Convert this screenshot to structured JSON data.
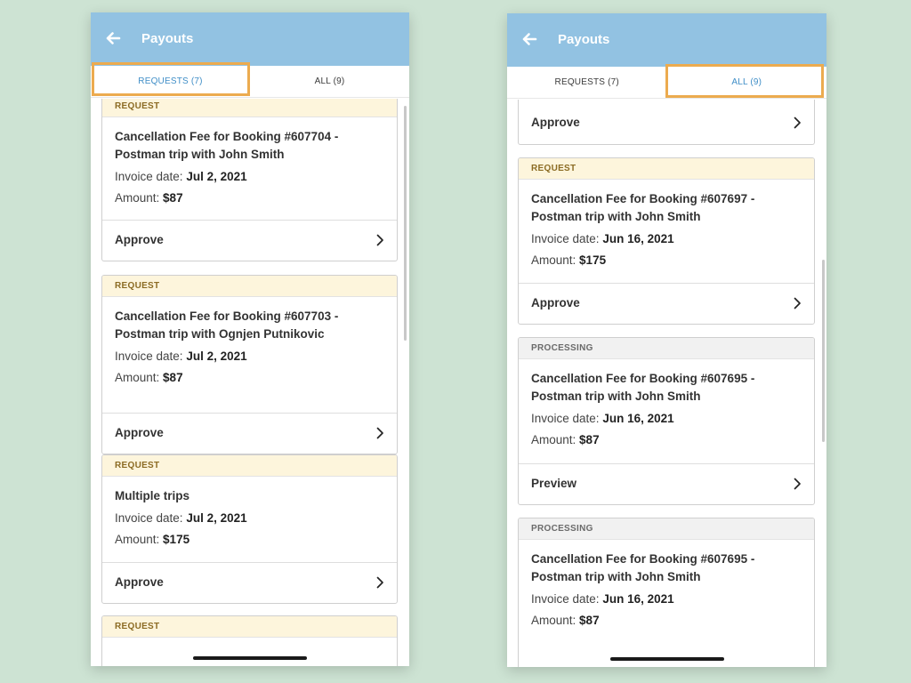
{
  "left_screen": {
    "title": "Payouts",
    "tabs": [
      {
        "label": "REQUESTS (7)",
        "active": true
      },
      {
        "label": "ALL (9)",
        "active": false
      }
    ],
    "cards": [
      {
        "status": "REQUEST",
        "title_line1": "Cancellation Fee for Booking #607704 -",
        "title_line2": "Postman trip  with John Smith",
        "invoice_label": "Invoice date:",
        "invoice_date": "Jul 2, 2021",
        "amount_label": "Amount:",
        "amount": "$87",
        "action": "Approve"
      },
      {
        "status": "REQUEST",
        "title_line1": "Cancellation Fee for Booking #607703 -",
        "title_line2": "Postman trip  with Ognjen Putnikovic",
        "invoice_label": "Invoice date:",
        "invoice_date": "Jul 2, 2021",
        "amount_label": "Amount:",
        "amount": "$87",
        "action": "Approve"
      },
      {
        "status": "REQUEST",
        "title_line1": "Multiple trips",
        "invoice_label": "Invoice date:",
        "invoice_date": "Jul 2, 2021",
        "amount_label": "Amount:",
        "amount": "$175",
        "action": "Approve"
      },
      {
        "status": "REQUEST"
      }
    ]
  },
  "right_screen": {
    "title": "Payouts",
    "tabs": [
      {
        "label": "REQUESTS (7)",
        "active": false
      },
      {
        "label": "ALL (9)",
        "active": true
      }
    ],
    "cards": [
      {
        "action": "Approve"
      },
      {
        "status": "REQUEST",
        "title_line1": "Cancellation Fee for Booking #607697 -",
        "title_line2": "Postman trip  with  John Smith",
        "invoice_label": "Invoice date:",
        "invoice_date": "Jun 16, 2021",
        "amount_label": "Amount:",
        "amount": "$175",
        "action": "Approve"
      },
      {
        "status": "PROCESSING",
        "title_line1": "Cancellation Fee for Booking #607695 -",
        "title_line2": "Postman trip  with  John Smith",
        "invoice_label": "Invoice date:",
        "invoice_date": "Jun 16, 2021",
        "amount_label": "Amount:",
        "amount": "$87",
        "action": "Preview"
      },
      {
        "status": "PROCESSING",
        "title_line1": "Cancellation Fee for Booking #607695 -",
        "title_line2": "Postman trip  with  John Smith",
        "invoice_label": "Invoice date:",
        "invoice_date": "Jun 16, 2021",
        "amount_label": "Amount:",
        "amount": "$87"
      }
    ]
  },
  "colors": {
    "background": "#cde3d3",
    "app_bar": "#92c2e2",
    "highlight_box": "#ecab4f",
    "active_tab_text": "#3f8ec7",
    "request_header_bg": "#fdf5dc",
    "processing_header_bg": "#f1f1f1"
  },
  "icons": {
    "back": "arrow-left-icon",
    "row_chevron": "chevron-right-icon"
  }
}
